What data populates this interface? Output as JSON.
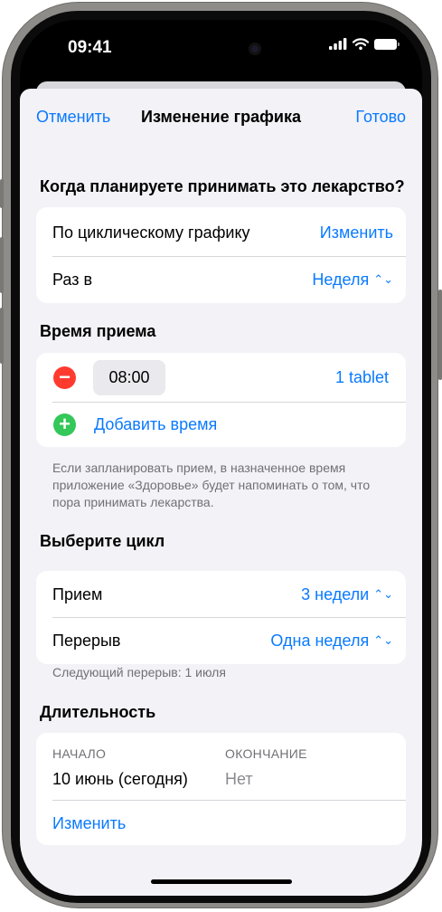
{
  "status_bar": {
    "time": "09:41"
  },
  "nav": {
    "cancel_label": "Отменить",
    "title": "Изменение графика",
    "done_label": "Готово"
  },
  "schedule": {
    "question": "Когда планируете принимать это лекарство?",
    "frequency_label": "По циклическому графику",
    "frequency_action": "Изменить",
    "every_label": "Раз в",
    "every_value": "Неделя"
  },
  "dose_time": {
    "title": "Время приема",
    "time": "08:00",
    "dose": "1 tablet",
    "add_label": "Добавить время",
    "footnote": "Если запланировать прием, в назначенное время приложение «Здоровье» будет напоминать о том, что пора принимать лекарства."
  },
  "cycle": {
    "title": "Выберите цикл",
    "intake_label": "Прием",
    "intake_value": "3 недели",
    "break_label": "Перерыв",
    "break_value": "Одна неделя",
    "footnote": "Следующий перерыв: 1 июля"
  },
  "duration": {
    "title": "Длительность",
    "start_caption": "НАЧАЛО",
    "start_value": "10 июнь (сегодня)",
    "end_caption": "ОКОНЧАНИЕ",
    "end_value": "Нет",
    "edit_label": "Изменить"
  },
  "colors": {
    "accent": "#0a7aff",
    "remove": "#ff3b30",
    "add": "#34c759",
    "background": "#f2f2f7"
  },
  "icons": [
    "signal-icon",
    "wifi-icon",
    "battery-icon",
    "chevron-updown-icon",
    "remove-icon",
    "add-icon"
  ]
}
